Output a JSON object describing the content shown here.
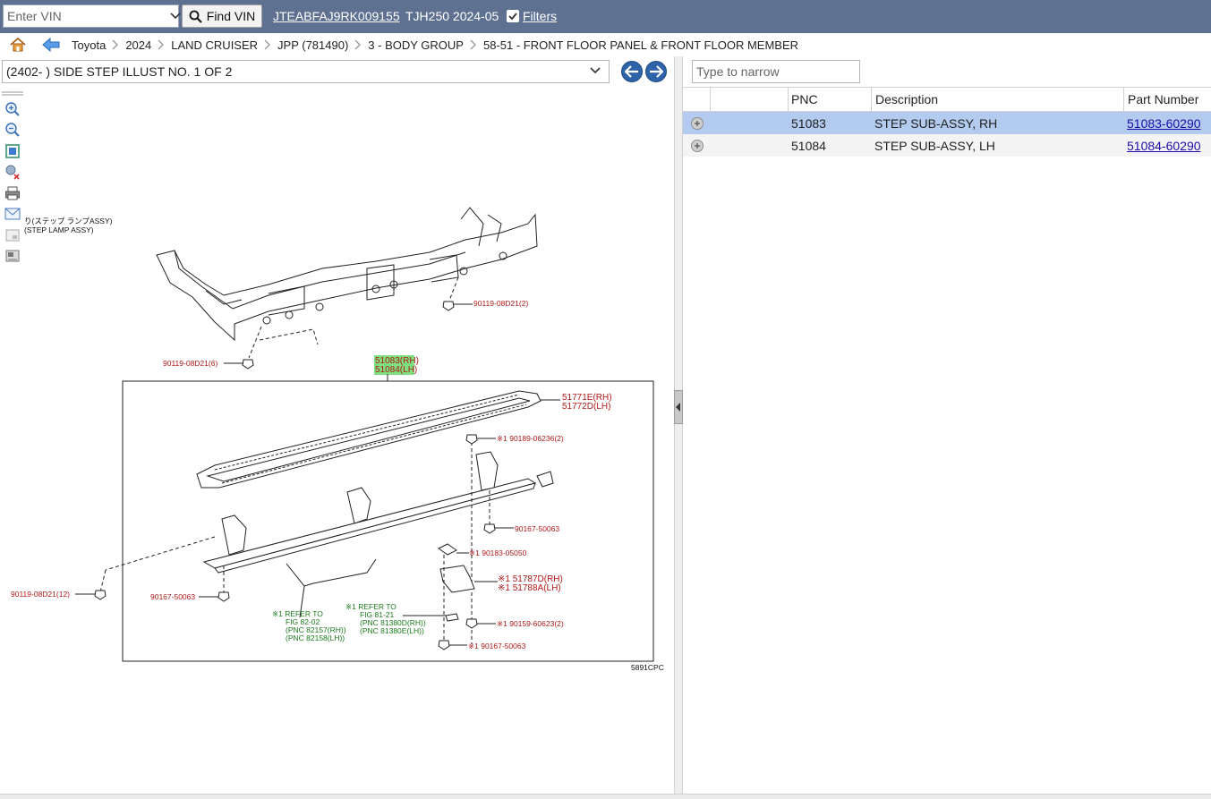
{
  "topbar": {
    "vin_placeholder": "Enter VIN",
    "find_label": "Find VIN",
    "vin": "JTEABFAJ9RK009155",
    "model": "TJH250 2024-05",
    "filters_label": "Filters",
    "filters_checked": true
  },
  "breadcrumb": [
    "Toyota",
    "2024",
    "LAND CRUISER",
    "JPP (781490)",
    "3 - BODY GROUP",
    "58-51 - FRONT FLOOR PANEL & FRONT FLOOR MEMBER"
  ],
  "illustration": {
    "selected": "(2402- ) SIDE STEP ILLUST NO. 1 OF 2",
    "figure_code": "5891CPC",
    "callouts": {
      "lamp_jp": "り(ステップ ランプASSY)",
      "lamp_en": "(STEP LAMP ASSY)",
      "bolt_a": "90119-08D21(2)",
      "bolt_b": "90119-08D21(6)",
      "step_rh": "51083(RH)",
      "step_lh": "51084(LH)",
      "pad_rh": "51771E(RH)",
      "pad_lh": "51772D(LH)",
      "clip_a": "※1 90189-06236(2)",
      "screw_a": "90167-50063",
      "clip_b": "※1 90183-05050",
      "brk_rh": "※1 51787D(RH)",
      "brk_lh": "※1 51788A(LH)",
      "bolt_c": "90119-08D21(12)",
      "screw_b": "90167-50063",
      "ref1_a": "※1 REFER TO",
      "ref1_b": "FIG 82-02",
      "ref1_c": "(PNC 82157(RH))",
      "ref1_d": "(PNC 82158(LH))",
      "ref2_a": "※1 REFER TO",
      "ref2_b": "FIG 81-21",
      "ref2_c": "(PNC 81380D(RH))",
      "ref2_d": "(PNC 81380E(LH))",
      "nut_a": "※1 90159-60623(2)",
      "screw_c": "※1 90167-50063"
    }
  },
  "parts": {
    "narrow_placeholder": "Type to narrow",
    "headers": {
      "pnc": "PNC",
      "description": "Description",
      "part_number": "Part Number"
    },
    "rows": [
      {
        "pnc": "51083",
        "description": "STEP SUB-ASSY, RH",
        "part_number": "51083-60290",
        "selected": true
      },
      {
        "pnc": "51084",
        "description": "STEP SUB-ASSY, LH",
        "part_number": "51084-60290",
        "selected": false
      }
    ]
  },
  "colors": {
    "topbar": "#5e7191",
    "selected_row": "#b3cbee",
    "callout_red": "#b01818",
    "callout_green": "#1a7a1a",
    "highlight": "#7fe07f",
    "link": "#1a0dab",
    "nav_button": "#2f63a8"
  },
  "icons": [
    "chevron-down-icon",
    "search-icon",
    "checkbox-icon",
    "home-icon",
    "back-arrow-icon",
    "breadcrumb-chevron-icon",
    "prev-circle-icon",
    "next-circle-icon",
    "zoom-in-icon",
    "zoom-out-icon",
    "fit-icon",
    "clear-icon",
    "print-icon",
    "mail-icon",
    "thumbnail-icon",
    "image-icon",
    "expand-icon",
    "collapse-arrow-icon"
  ]
}
